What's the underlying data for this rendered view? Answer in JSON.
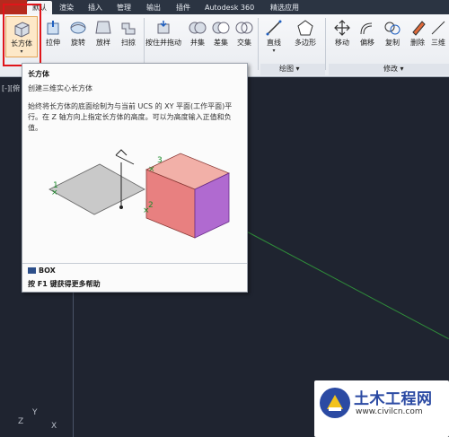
{
  "tabs": [
    {
      "label": "默认"
    },
    {
      "label": "渲染"
    },
    {
      "label": "插入"
    },
    {
      "label": "管理"
    },
    {
      "label": "输出"
    },
    {
      "label": "插件"
    },
    {
      "label": "Autodesk 360"
    },
    {
      "label": "精选应用"
    }
  ],
  "ribbon": {
    "buttons": [
      {
        "label": "长方体",
        "icon": "box-icon"
      },
      {
        "label": "拉伸",
        "icon": "extrude-icon"
      },
      {
        "label": "旋转",
        "icon": "revolve-icon"
      },
      {
        "label": "放样",
        "icon": "loft-icon"
      },
      {
        "label": "扫掠",
        "icon": "sweep-icon"
      },
      {
        "label": "按住并拖动",
        "icon": "presspull-icon"
      },
      {
        "label": "并集",
        "icon": "union-icon"
      },
      {
        "label": "差集",
        "icon": "subtract-icon"
      },
      {
        "label": "交集",
        "icon": "intersect-icon"
      },
      {
        "label": "直线",
        "icon": "line-icon"
      },
      {
        "label": "多边形",
        "icon": "polygon-icon"
      },
      {
        "label": "移动",
        "icon": "move-icon"
      },
      {
        "label": "偏移",
        "icon": "offset-icon"
      },
      {
        "label": "复制",
        "icon": "copy-icon"
      },
      {
        "label": "删除",
        "icon": "erase-icon"
      },
      {
        "label": "三维",
        "icon": "3d-icon"
      }
    ],
    "panels": {
      "draw": "绘图 ▾",
      "modify": "修改 ▾"
    }
  },
  "viewport": {
    "label": "[-][俯"
  },
  "tooltip": {
    "title": "长方体",
    "subtitle": "创建三维实心长方体",
    "description": "始终将长方体的底面绘制为与当前 UCS 的 XY 平面(工作平面)平行。在 Z 轴方向上指定长方体的高度。可以为高度输入正值和负值。",
    "points": [
      "1",
      "2",
      "3"
    ],
    "command": "BOX",
    "help": "按 F1 键获得更多帮助"
  },
  "axes": {
    "y": "Y",
    "x": "X",
    "z": "Z"
  },
  "watermark": {
    "name": "土木工程网",
    "url": "www.civilcn.com"
  },
  "colors": {
    "accent_red": "#e0151a",
    "box_red": "#e88080",
    "box_purple": "#b06ad0",
    "grid_green": "#2f8c3a"
  }
}
